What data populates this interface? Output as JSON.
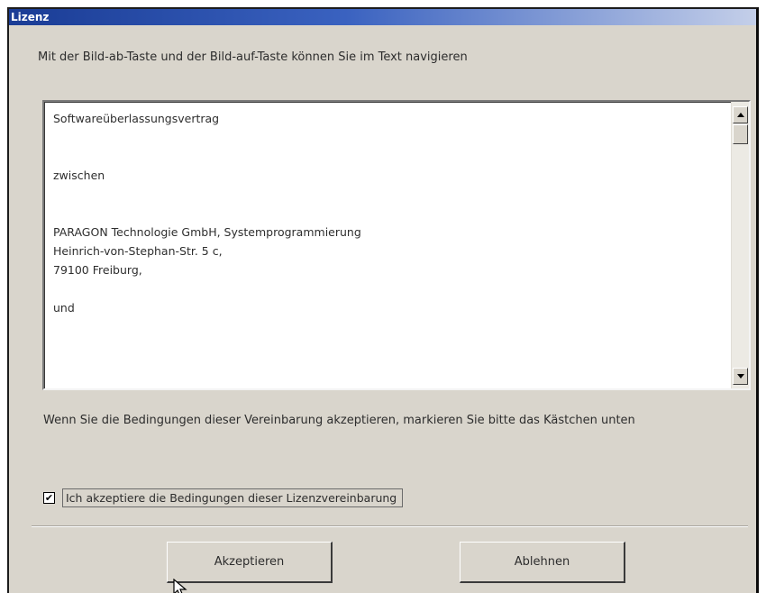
{
  "window": {
    "title": "Lizenz"
  },
  "instruction": "Mit der Bild-ab-Taste und der Bild-auf-Taste können Sie im Text navigieren",
  "license_text": {
    "lines": [
      "Softwareüberlassungsvertrag",
      "",
      "",
      "zwischen",
      "",
      "",
      "PARAGON Technologie GmbH, Systemprogrammierung",
      "Heinrich-von-Stephan-Str. 5 c,",
      "79100 Freiburg,",
      "",
      "und"
    ]
  },
  "scrollbar": {
    "up_icon": "scroll-up-arrow-icon",
    "down_icon": "scroll-down-arrow-icon"
  },
  "conditions_text": "Wenn Sie die Bedingungen dieser Vereinbarung akzeptieren, markieren Sie bitte das Kästchen unten",
  "accept_checkbox": {
    "checked": true,
    "label": "Ich akzeptiere die Bedingungen dieser Lizenzvereinbarung"
  },
  "buttons": {
    "accept": {
      "label": "Akzeptieren"
    },
    "reject": {
      "label": "Ablehnen"
    }
  },
  "cursor_icon": "mouse-pointer-icon"
}
